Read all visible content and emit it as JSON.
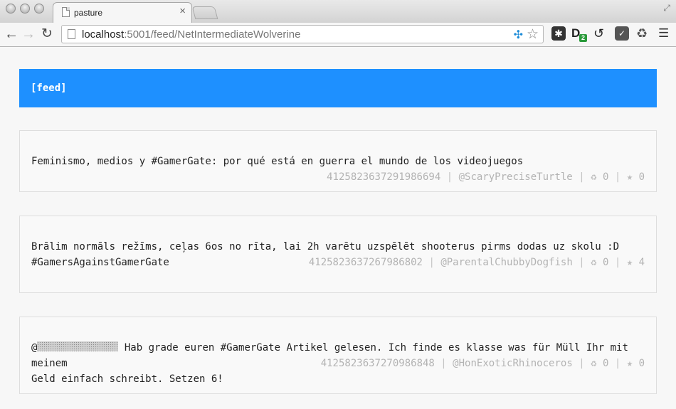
{
  "browser": {
    "tab_title": "pasture",
    "tab_close": "×",
    "url_host": "localhost",
    "url_rest": ":5001/feed/NetIntermediateWolverine",
    "nav": {
      "back": "←",
      "forward": "→",
      "reload": "↻"
    },
    "star": "☆",
    "extensions": [
      {
        "name": "puzzle-extension-icon",
        "glyph": "✱"
      },
      {
        "name": "d-extension-icon",
        "glyph": "D",
        "badge": "2"
      },
      {
        "name": "sync-extension-icon",
        "glyph": "↺"
      },
      {
        "name": "pocket-extension-icon",
        "glyph": "✓"
      },
      {
        "name": "recycle-extension-icon",
        "glyph": "♻"
      },
      {
        "name": "menu-icon",
        "glyph": "☰"
      }
    ]
  },
  "feed": {
    "title": "[feed]"
  },
  "posts": [
    {
      "text": "Feminismo, medios y #GamerGate: por qué está en guerra el mundo de los videojuegos",
      "id": "4125823637291986694",
      "user": "@ScaryPreciseTurtle",
      "reposts": "0",
      "stars": "0"
    },
    {
      "text": "Brālim normāls režīms, ceļas 6os no rīta, lai 2h varētu uzspēlēt shooterus pirms dodas uz skolu :D\n#GamersAgainstGamerGate",
      "id": "4125823637267986802",
      "user": "@ParentalChubbyDogfish",
      "reposts": "0",
      "stars": "4"
    },
    {
      "text_prefix": "@",
      "text_after": " Hab grade euren #GamerGate Artikel gelesen. Ich finde es klasse was für Müll Ihr mit meinem\nGeld einfach schreibt. Setzen 6!",
      "id": "4125823637270986848",
      "user": "@HonExoticRhinoceros",
      "reposts": "0",
      "stars": "0"
    }
  ],
  "icons": {
    "repost": "♻",
    "star": "★",
    "separator": "|"
  },
  "colors": {
    "header": "#1e90ff",
    "meta": "#b3b3b3"
  }
}
